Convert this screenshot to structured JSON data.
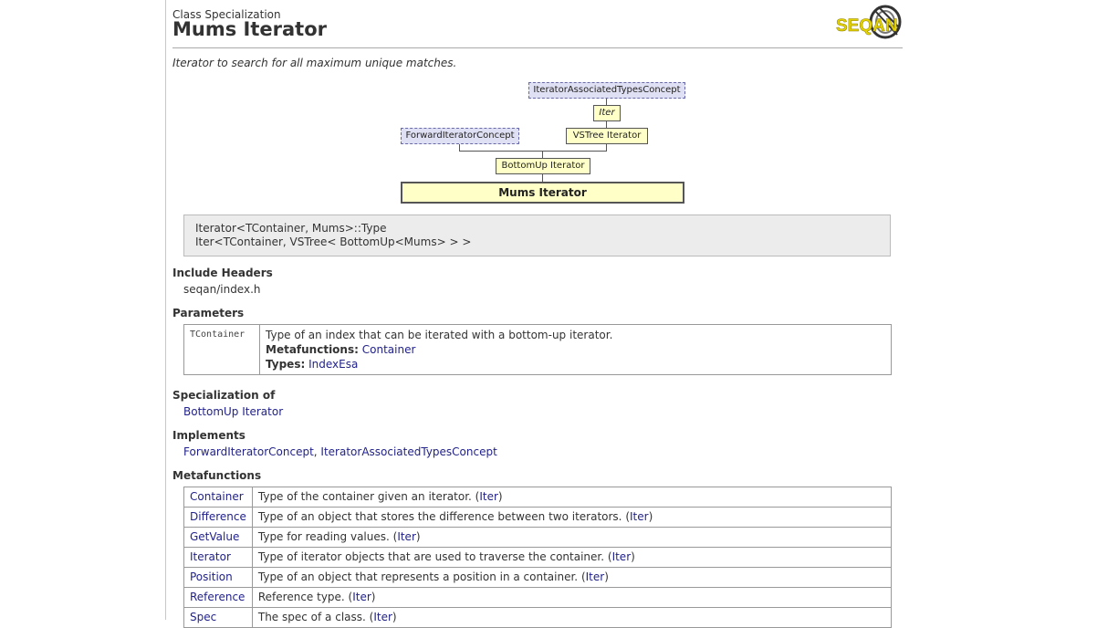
{
  "header": {
    "kind": "Class Specialization",
    "title": "Mums Iterator",
    "logo_text": "SEQAN",
    "summary": "Iterator to search for all maximum unique matches."
  },
  "diagram": {
    "nodes": {
      "iat": "IteratorAssociatedTypesConcept",
      "iter": "Iter",
      "fic": "ForwardIteratorConcept",
      "vstree": "VSTree Iterator",
      "bottomup": "BottomUp Iterator",
      "mums": "Mums Iterator"
    }
  },
  "signature": {
    "line1": "Iterator<TContainer, Mums>::Type",
    "line2": "Iter<TContainer, VSTree< BottomUp<Mums> > >"
  },
  "include": {
    "heading": "Include Headers",
    "value": "seqan/index.h"
  },
  "parameters": {
    "heading": "Parameters",
    "rows": [
      {
        "name": "TContainer",
        "desc": "Type of an index that can be iterated with a bottom-up iterator.",
        "meta_label": "Metafunctions:",
        "meta_value": "Container",
        "types_label": "Types:",
        "types_value": "IndexEsa"
      }
    ]
  },
  "specialization": {
    "heading": "Specialization of",
    "value": "BottomUp Iterator"
  },
  "implements": {
    "heading": "Implements",
    "link1": "ForwardIteratorConcept",
    "sep": ", ",
    "link2": "IteratorAssociatedTypesConcept"
  },
  "metafunctions": {
    "heading": "Metafunctions",
    "rows": [
      {
        "name": "Container",
        "desc": "Type of the container given an iterator. (",
        "link": "Iter",
        "end": ")"
      },
      {
        "name": "Difference",
        "desc": "Type of an object that stores the difference between two iterators. (",
        "link": "Iter",
        "end": ")"
      },
      {
        "name": "GetValue",
        "desc": "Type for reading values. (",
        "link": "Iter",
        "end": ")"
      },
      {
        "name": "Iterator",
        "desc": "Type of iterator objects that are used to traverse the container. (",
        "link": "Iter",
        "end": ")"
      },
      {
        "name": "Position",
        "desc": "Type of an object that represents a position in a container. (",
        "link": "Iter",
        "end": ")"
      },
      {
        "name": "Reference",
        "desc": "Reference type. (",
        "link": "Iter",
        "end": ")"
      },
      {
        "name": "Spec",
        "desc": "The spec of a class. (",
        "link": "Iter",
        "end": ")"
      }
    ]
  }
}
